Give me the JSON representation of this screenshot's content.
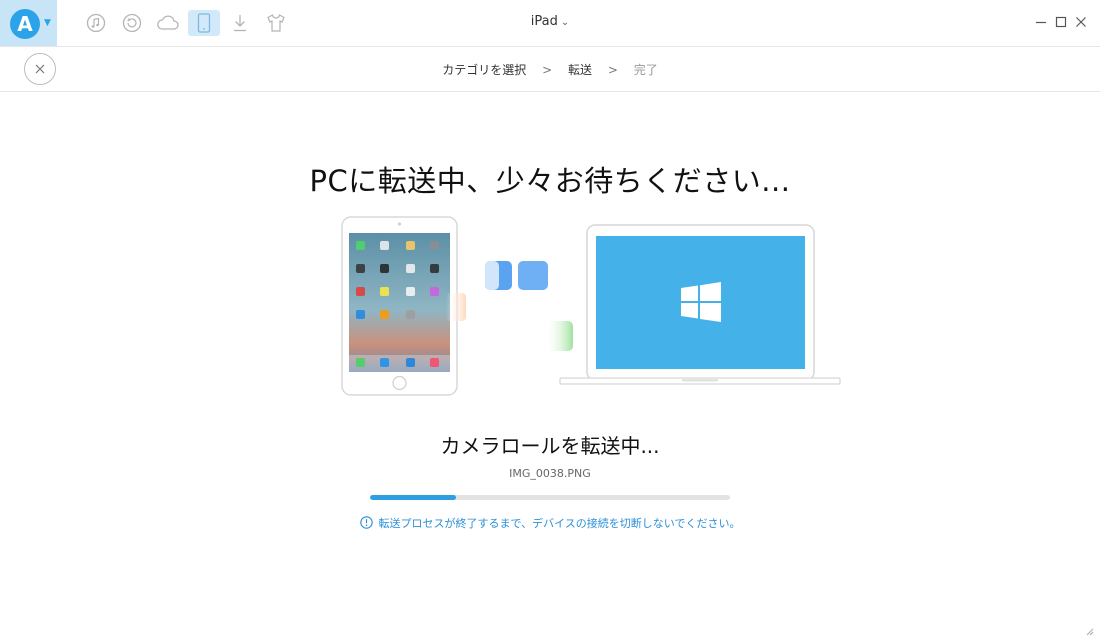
{
  "app": {
    "logo_letter": "A",
    "device_name": "iPad",
    "accent": "#2aa3e8"
  },
  "toolbar": {
    "icons": [
      "music-icon",
      "restore-icon",
      "cloud-icon",
      "device-icon",
      "download-icon",
      "tshirt-icon"
    ],
    "active": "device-icon"
  },
  "breadcrumb": {
    "steps": [
      "カテゴリを選択",
      "転送",
      "完了"
    ],
    "separator": ">"
  },
  "main": {
    "headline": "PCに転送中、少々お待ちください...",
    "status": "カメラロールを転送中...",
    "current_file": "IMG_0038.PNG",
    "progress_percent": 24,
    "warning": "転送プロセスが終了するまで、デバイスの接続を切断しないでください。"
  }
}
